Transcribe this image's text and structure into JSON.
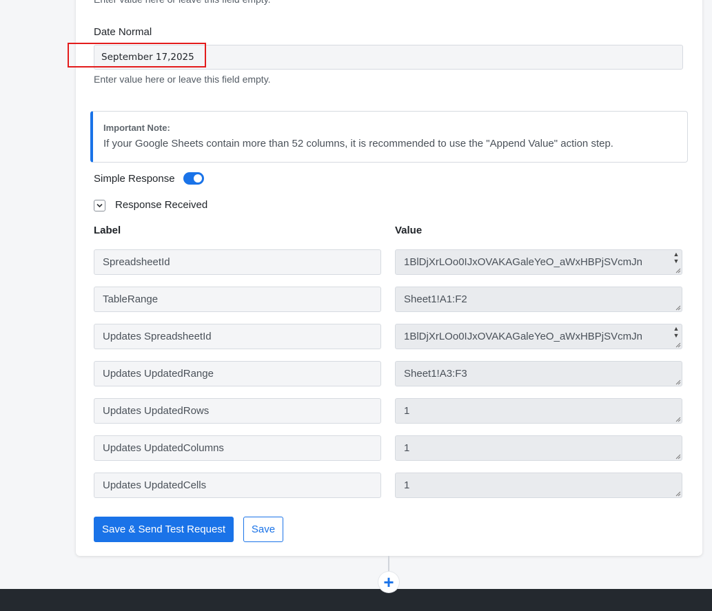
{
  "form": {
    "hint_text": "Enter value here or leave this field empty.",
    "date_field": {
      "label": "Date Normal",
      "value": "September 17,2025"
    }
  },
  "note": {
    "title": "Important Note:",
    "text": "If your Google Sheets contain more than 52 columns, it is recommended to use the \"Append Value\" action step."
  },
  "simple_response": {
    "label": "Simple Response",
    "enabled": true
  },
  "response_received": {
    "label": "Response Received",
    "expanded": true
  },
  "table": {
    "label_header": "Label",
    "value_header": "Value",
    "rows": [
      {
        "label": "SpreadsheetId",
        "value": "1BlDjXrLOo0IJxOVAKAGaleYeO_aWxHBPjSVcmJn"
      },
      {
        "label": "TableRange",
        "value": "Sheet1!A1:F2"
      },
      {
        "label": "Updates SpreadsheetId",
        "value": "1BlDjXrLOo0IJxOVAKAGaleYeO_aWxHBPjSVcmJn"
      },
      {
        "label": "Updates UpdatedRange",
        "value": "Sheet1!A3:F3"
      },
      {
        "label": "Updates UpdatedRows",
        "value": "1"
      },
      {
        "label": "Updates UpdatedColumns",
        "value": "1"
      },
      {
        "label": "Updates UpdatedCells",
        "value": "1"
      }
    ]
  },
  "buttons": {
    "send_test": "Save & Send Test Request",
    "save": "Save"
  },
  "add_step_symbol": "+",
  "colors": {
    "accent": "#1a73e8",
    "highlight": "#e31b1b"
  }
}
